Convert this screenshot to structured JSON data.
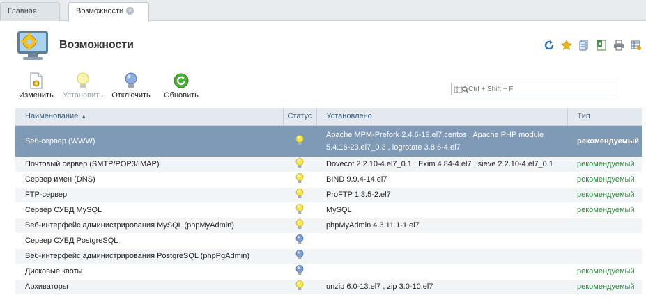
{
  "tabs": [
    {
      "label": "Главная",
      "active": false
    },
    {
      "label": "Возможности",
      "active": true
    }
  ],
  "page": {
    "title": "Возможности"
  },
  "top_tools": [
    "refresh-icon",
    "star-icon",
    "copy-icon",
    "excel-icon",
    "print-icon",
    "table-settings-icon"
  ],
  "toolbar": {
    "edit_label": "Изменить",
    "install_label": "Установить",
    "disable_label": "Отключить",
    "update_label": "Обновить"
  },
  "search": {
    "placeholder": "Ctrl + Shift + F"
  },
  "table": {
    "columns": {
      "name": "Наименование",
      "status": "Статус",
      "installed": "Установлено",
      "type": "Тип"
    },
    "rows": [
      {
        "name": "Веб-сервер (WWW)",
        "status": "on",
        "installed": "Apache MPM-Prefork 2.4.6-19.el7.centos , Apache PHP module 5.4.16-23.el7_0.3 , logrotate 3.8.6-4.el7",
        "type": "рекомендуемый"
      },
      {
        "name": "Почтовый сервер (SMTP/POP3/IMAP)",
        "status": "on",
        "installed": "Dovecot 2.2.10-4.el7_0.1 , Exim 4.84-4.el7 , sieve 2.2.10-4.el7_0.1",
        "type": "рекомендуемый"
      },
      {
        "name": "Сервер имен (DNS)",
        "status": "on",
        "installed": "BIND 9.9.4-14.el7",
        "type": "рекомендуемый"
      },
      {
        "name": "FTP-сервер",
        "status": "on",
        "installed": "ProFTP 1.3.5-2.el7",
        "type": "рекомендуемый"
      },
      {
        "name": "Сервер СУБД MySQL",
        "status": "on",
        "installed": "MySQL",
        "type": "рекомендуемый"
      },
      {
        "name": "Веб-интерфейс администрирования MySQL (phpMyAdmin)",
        "status": "on",
        "installed": "phpMyAdmin 4.3.11.1-1.el7",
        "type": ""
      },
      {
        "name": "Сервер СУБД PostgreSQL",
        "status": "off",
        "installed": "",
        "type": ""
      },
      {
        "name": "Веб-интерфейс администрирования PostgreSQL (phpPgAdmin)",
        "status": "off",
        "installed": "",
        "type": ""
      },
      {
        "name": "Дисковые квоты",
        "status": "off",
        "installed": "",
        "type": "рекомендуемый"
      },
      {
        "name": "Архиваторы",
        "status": "on",
        "installed": "unzip 6.0-13.el7 , zip 3.0-10.el7",
        "type": "рекомендуемый"
      }
    ]
  },
  "colors": {
    "selected_row": "#7f9ab6",
    "recommended": "#2e8b3e",
    "bulb_on": "#f3e651",
    "bulb_off": "#7e9fd4"
  }
}
